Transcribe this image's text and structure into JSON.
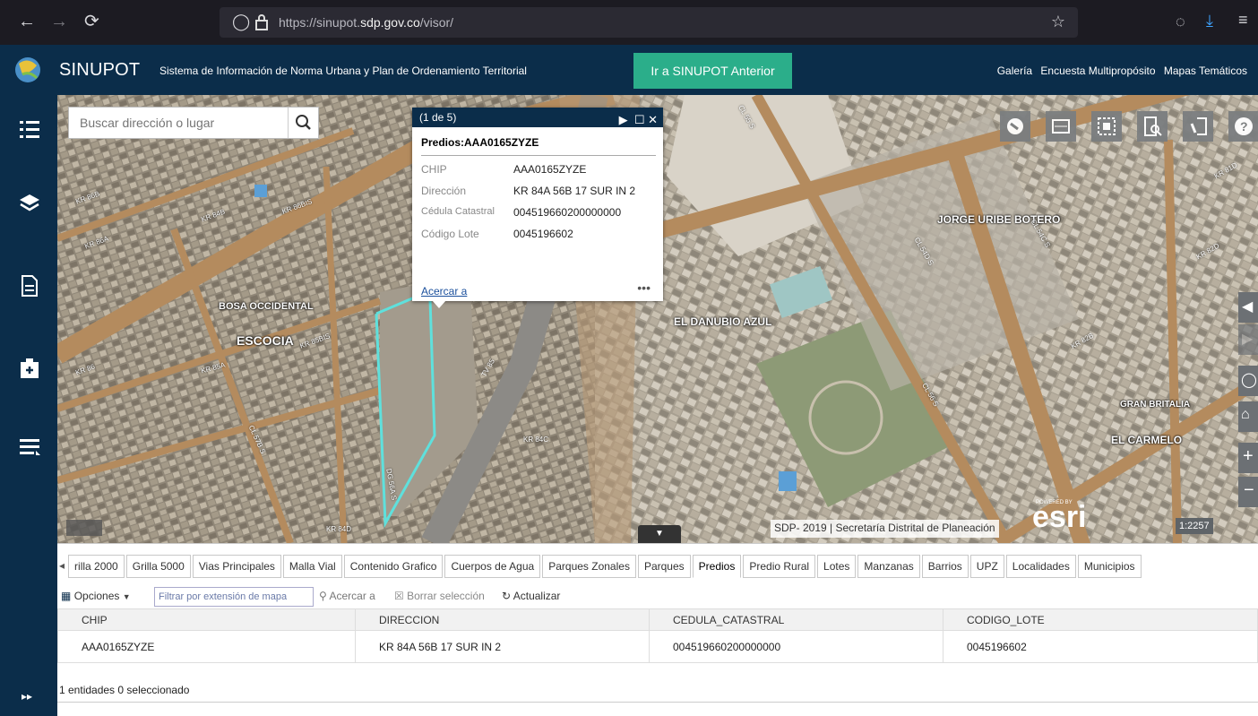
{
  "browser": {
    "url_prefix": "https://sinupot.",
    "url_domain": "sdp.gov.co",
    "url_path": "/visor/"
  },
  "header": {
    "app_name": "SINUPOT",
    "subtitle": "Sistema de Información de Norma Urbana y Plan de Ordenamiento Territorial",
    "old_button": "Ir a SINUPOT Anterior",
    "links": [
      "Galería",
      "Encuesta Multipropósito",
      "Mapas Temáticos"
    ]
  },
  "colors": {
    "header_bg": "#0b2d4a",
    "accent": "#2bae8a",
    "highlight": "#5fe0dc"
  },
  "search": {
    "placeholder": "Buscar dirección o lugar"
  },
  "popup": {
    "counter": "(1 de 5)",
    "title": "Predios:AAA0165ZYZE",
    "attributes": [
      {
        "key": "CHIP",
        "value": "AAA0165ZYZE"
      },
      {
        "key": "Dirección",
        "value": "KR 84A 56B 17 SUR IN 2"
      },
      {
        "key": "Cédula Catastral",
        "value": "004519660200000000"
      },
      {
        "key": "Código Lote",
        "value": "0045196602"
      }
    ],
    "zoom_link": "Acercar a",
    "more": "•••"
  },
  "map": {
    "labels": [
      "JORGE URIBE BOTERO",
      "EL DANUBIO AZUL",
      "BOSA OCCIDENTAL",
      "ESCOCIA",
      "GRAN BRITALIA",
      "EL CARMELO"
    ],
    "streets": [
      "KR 86B",
      "KR 86A",
      "KR 85A",
      "KR 86",
      "CL 57B S",
      "TV 85",
      "DG 56A S",
      "KR 84D",
      "CL 55 S",
      "CL 54D S",
      "KR 82B",
      "KR 82D",
      "KR 81D",
      "CL 56 S",
      "KR 84C",
      "CL 54C S",
      "KR 86BIS",
      "KR 85BIS",
      "KR 84B"
    ],
    "credits": "SDP- 2019 | Secretaría Distrital de Planeación",
    "esri": "esri",
    "powered": "POWERED BY",
    "scale": "1:2257"
  },
  "table": {
    "tabs": [
      "rilla 2000",
      "Grilla 5000",
      "Vias Principales",
      "Malla Vial",
      "Contenido Grafico",
      "Cuerpos de Agua",
      "Parques Zonales",
      "Parques",
      "Predios",
      "Predio Rural",
      "Lotes",
      "Manzanas",
      "Barrios",
      "UPZ",
      "Localidades",
      "Municipios"
    ],
    "active_tab": "Predios",
    "toolbar": {
      "options": "Opciones",
      "filter": "Filtrar por extensión de mapa",
      "zoom": "Acercar a",
      "clear": "Borrar selección",
      "refresh": "Actualizar"
    },
    "columns": [
      "CHIP",
      "DIRECCION",
      "CEDULA_CATASTRAL",
      "CODIGO_LOTE"
    ],
    "rows": [
      [
        "AAA0165ZYZE",
        "KR 84A 56B 17 SUR IN 2",
        "004519660200000000",
        "0045196602"
      ]
    ],
    "status": "1 entidades 0 seleccionado"
  }
}
